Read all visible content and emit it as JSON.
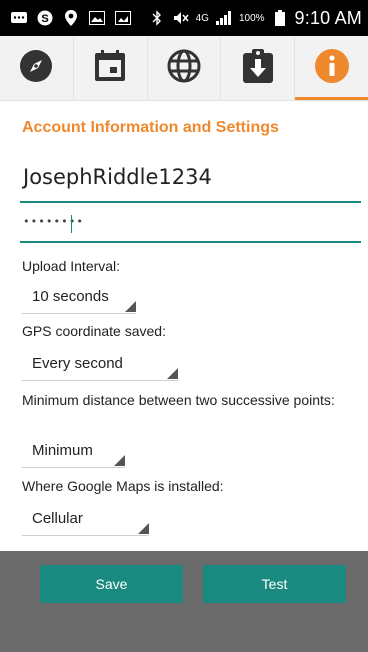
{
  "status_bar": {
    "battery_percent": "100%",
    "time": "9:10 AM",
    "network": "4G"
  },
  "tabs": [
    {
      "icon": "compass-icon",
      "active": false
    },
    {
      "icon": "calendar-icon",
      "active": false
    },
    {
      "icon": "globe-icon",
      "active": false
    },
    {
      "icon": "clipboard-download-icon",
      "active": false
    },
    {
      "icon": "info-icon",
      "active": true
    }
  ],
  "colors": {
    "accent": "#f0892e",
    "teal": "#1a8a80",
    "footer": "#6b6b6b"
  },
  "settings": {
    "title": "Account Information and Settings",
    "username": "JosephRiddle1234",
    "password_mask": "••••••••",
    "upload_interval_label": "Upload Interval:",
    "upload_interval_value": "10 seconds",
    "gps_label": "GPS coordinate saved:",
    "gps_value": "Every second",
    "min_distance_label": "Minimum distance between two successive points:",
    "min_distance_value": "Minimum",
    "maps_label": "Where Google Maps is installed:",
    "maps_value": "Cellular"
  },
  "buttons": {
    "save": "Save",
    "test": "Test"
  }
}
